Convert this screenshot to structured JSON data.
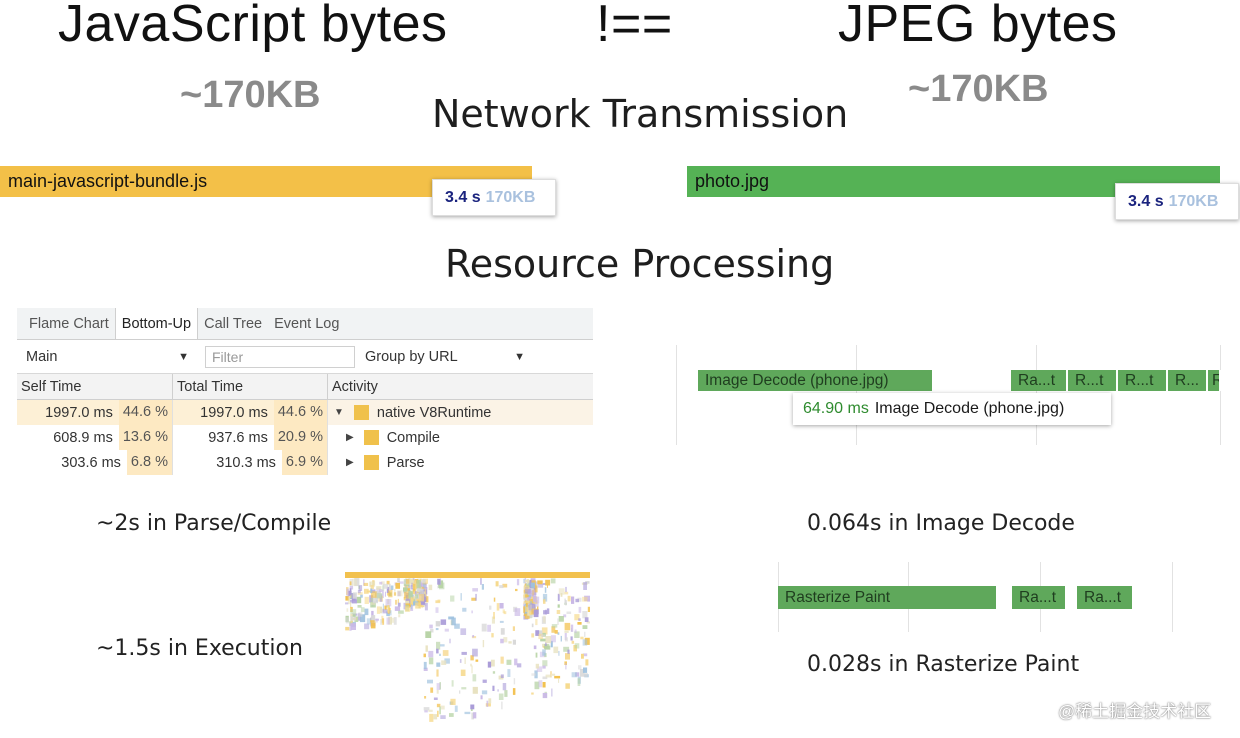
{
  "header": {
    "left_title": "JavaScript bytes",
    "operator": "!==",
    "right_title": "JPEG bytes",
    "left_size": "~170KB",
    "right_size": "~170KB"
  },
  "network": {
    "section_title": "Network Transmission",
    "left_bar": {
      "label": "main-javascript-bundle.js",
      "color": "#f3c048",
      "time": "3.4 s",
      "size": "170KB"
    },
    "right_bar": {
      "label": "photo.jpg",
      "color": "#55b255",
      "time": "3.4 s",
      "size": "170KB"
    }
  },
  "processing": {
    "section_title": "Resource Processing"
  },
  "devtools": {
    "tabs": [
      "Flame Chart",
      "Bottom-Up",
      "Call Tree",
      "Event Log"
    ],
    "active_tab": "Bottom-Up",
    "thread_select": "Main",
    "filter_placeholder": "Filter",
    "group_select": "Group by URL",
    "columns": [
      "Self Time",
      "Total Time",
      "Activity"
    ],
    "rows": [
      {
        "self_ms": "1997.0 ms",
        "self_pct": "44.6 %",
        "total_ms": "1997.0 ms",
        "total_pct": "44.6 %",
        "activity": "native V8Runtime",
        "expanded": true
      },
      {
        "self_ms": "608.9 ms",
        "self_pct": "13.6 %",
        "total_ms": "937.6 ms",
        "total_pct": "20.9 %",
        "activity": "Compile",
        "expanded": false
      },
      {
        "self_ms": "303.6 ms",
        "self_pct": "6.8 %",
        "total_ms": "310.3 ms",
        "total_pct": "6.9 %",
        "activity": "Parse",
        "expanded": false
      }
    ]
  },
  "image_trace": {
    "decode_bar": "Image Decode (phone.jpg)",
    "small_bars": [
      "Ra...t",
      "R...t",
      "R...t",
      "R...",
      "R"
    ],
    "tooltip_time": "64.90 ms",
    "tooltip_label": "Image Decode (phone.jpg)"
  },
  "raster_trace": {
    "bars": [
      "Rasterize Paint",
      "Ra...t",
      "Ra...t"
    ]
  },
  "captions": {
    "parse_compile": "~2s in Parse/Compile",
    "execution": "~1.5s in Execution",
    "image_decode": "0.064s in Image Decode",
    "rasterize": "0.028s in Rasterize Paint"
  },
  "watermark": "@稀土掘金技术社区"
}
